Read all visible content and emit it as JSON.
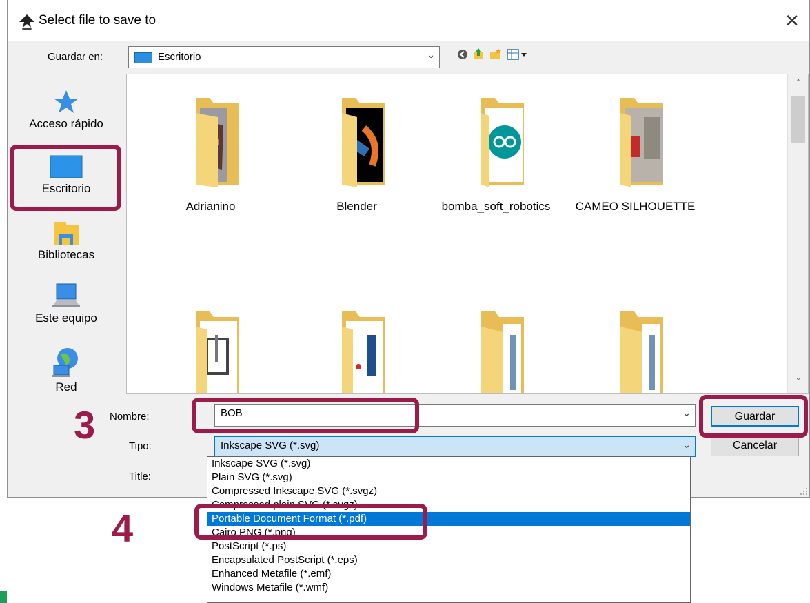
{
  "window": {
    "title": "Select file to save to",
    "close_glyph": "✕"
  },
  "location": {
    "label": "Guardar en:",
    "value": "Escritorio"
  },
  "toolbar_icons": [
    "back-icon",
    "up-folder-icon",
    "new-folder-icon",
    "view-menu-icon"
  ],
  "places": [
    {
      "label": "Acceso rápido",
      "icon": "star-icon"
    },
    {
      "label": "Escritorio",
      "icon": "desktop-icon"
    },
    {
      "label": "Bibliotecas",
      "icon": "libraries-icon"
    },
    {
      "label": "Este equipo",
      "icon": "computer-icon"
    },
    {
      "label": "Red",
      "icon": "network-icon"
    }
  ],
  "files": [
    {
      "name": "Adrianino"
    },
    {
      "name": "Blender"
    },
    {
      "name": "bomba_soft_robotics"
    },
    {
      "name": "CAMEO SILHOUETTE"
    },
    {
      "name": ""
    },
    {
      "name": ""
    },
    {
      "name": ""
    },
    {
      "name": ""
    }
  ],
  "form": {
    "name_label": "Nombre:",
    "name_value": "BOB",
    "type_label": "Tipo:",
    "type_value": "Inkscape SVG (*.svg)",
    "title_label": "Title:"
  },
  "buttons": {
    "save": "Guardar",
    "cancel": "Cancelar"
  },
  "type_options": [
    "Inkscape SVG (*.svg)",
    "Plain SVG (*.svg)",
    "Compressed Inkscape SVG (*.svgz)",
    "Compressed plain SVG (*.svgz)",
    "Portable Document Format (*.pdf)",
    "Cairo PNG (*.png)",
    "PostScript (*.ps)",
    "Encapsulated PostScript (*.eps)",
    "Enhanced Metafile (*.emf)",
    "Windows Metafile (*.wmf)"
  ],
  "selected_type_index": 4,
  "annotations": {
    "step3": "3",
    "step4": "4"
  },
  "colors": {
    "accent": "#0078d7",
    "highlight": "#9b1b4a",
    "folder": "#f5d57a"
  }
}
